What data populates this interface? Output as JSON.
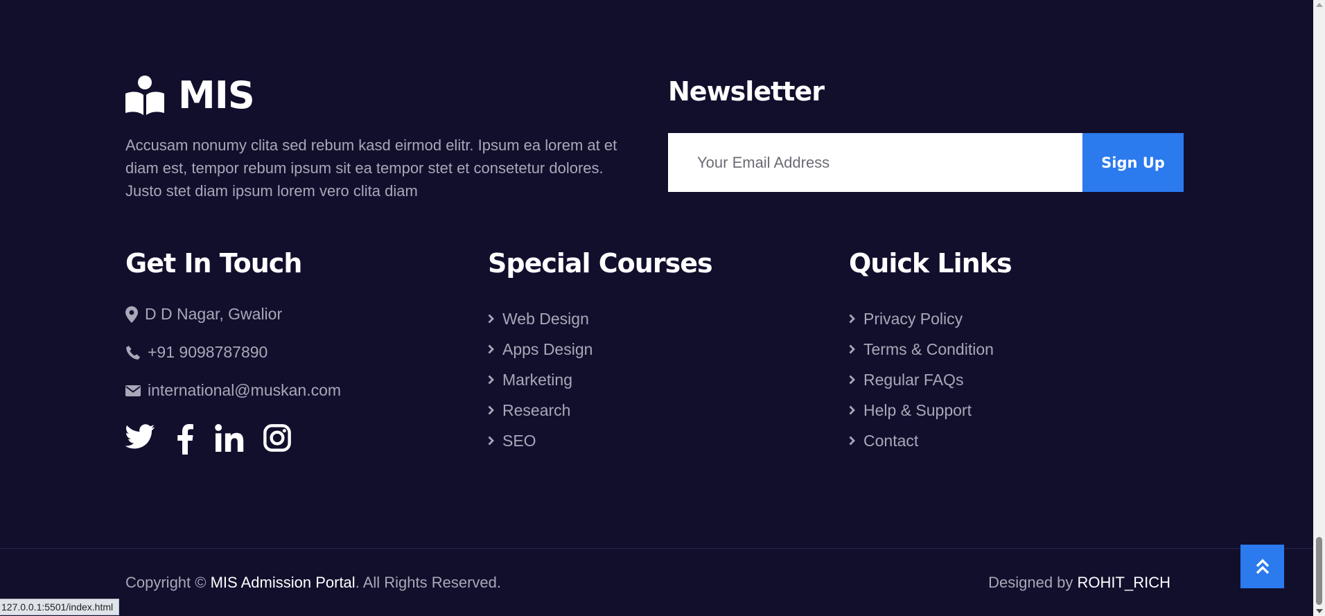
{
  "brand": {
    "name": "MIS",
    "icon": "book-reader-icon"
  },
  "about_text": "Accusam nonumy clita sed rebum kasd eirmod elitr. Ipsum ea lorem at et diam est, tempor rebum ipsum sit ea tempor stet et consetetur dolores. Justo stet diam ipsum lorem vero clita diam",
  "newsletter": {
    "title": "Newsletter",
    "placeholder": "Your Email Address",
    "button": "Sign Up"
  },
  "contact": {
    "title": "Get In Touch",
    "address": "D D Nagar, Gwalior",
    "phone": "+91 9098787890",
    "email": "international@muskan.com"
  },
  "social": [
    "twitter-icon",
    "facebook-icon",
    "linkedin-icon",
    "instagram-icon"
  ],
  "courses": {
    "title": "Special Courses",
    "items": [
      "Web Design",
      "Apps Design",
      "Marketing",
      "Research",
      "SEO"
    ]
  },
  "quick_links": {
    "title": "Quick Links",
    "items": [
      "Privacy Policy",
      "Terms & Condition",
      "Regular FAQs",
      "Help & Support",
      "Contact"
    ]
  },
  "footer": {
    "copy_prefix": "Copyright ©",
    "portal": "MIS Admission Portal",
    "copy_suffix": ". All Rights Reserved.",
    "designed_by": "Designed by",
    "designer": "ROHIT_RICH"
  },
  "status_url": "127.0.0.1:5501/index.html",
  "colors": {
    "background": "#120f2d",
    "accent": "#2b7aee",
    "muted_text": "#a9a7b8"
  }
}
